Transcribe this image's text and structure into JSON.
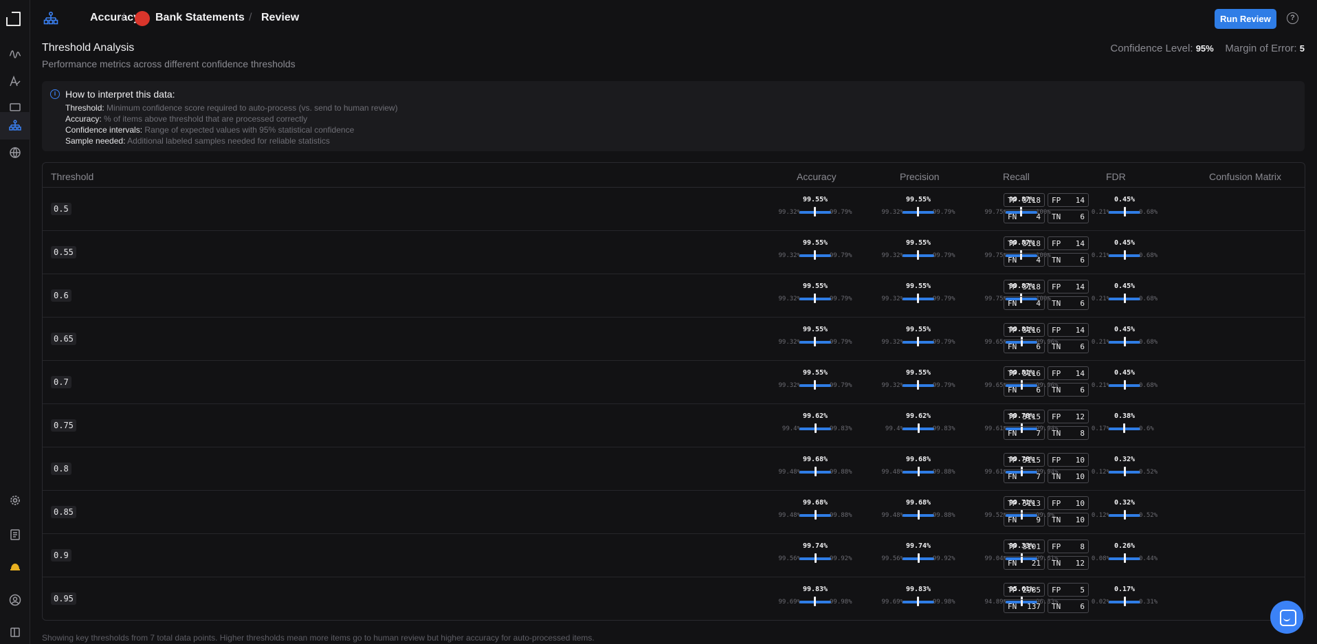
{
  "breadcrumb": {
    "section": "Accuracy",
    "project": "Bank Statements",
    "page": "Review",
    "separator": "/"
  },
  "header": {
    "run_button": "Run Review",
    "help_icon": "?"
  },
  "analysis": {
    "title": "Threshold Analysis",
    "subtitle": "Performance metrics across different confidence thresholds",
    "confidence_label": "Confidence Level:",
    "confidence_value": "95%",
    "margin_label": "Margin of Error:",
    "margin_value": "5"
  },
  "info": {
    "title": "How to interpret this data:",
    "lines": [
      {
        "key": "Threshold:",
        "text": "Minimum confidence score required to auto-process (vs. send to human review)"
      },
      {
        "key": "Accuracy:",
        "text": "% of items above threshold that are processed correctly"
      },
      {
        "key": "Confidence intervals:",
        "text": "Range of expected values with 95% statistical confidence"
      },
      {
        "key": "Sample needed:",
        "text": "Additional labeled samples needed for reliable statistics"
      }
    ]
  },
  "table": {
    "columns": [
      "Threshold",
      "Accuracy",
      "Precision",
      "Recall",
      "FDR",
      "Confusion Matrix"
    ],
    "cm_labels": [
      "TP",
      "FP",
      "FN",
      "TN"
    ],
    "rows": [
      {
        "threshold": "0.5",
        "acc": [
          "99.55%",
          "99.32%",
          "99.79%"
        ],
        "prec": [
          "99.55%",
          "99.32%",
          "99.79%"
        ],
        "rec": [
          "99.87%",
          "99.75%",
          "100%"
        ],
        "fdr": [
          "0.45%",
          "0.21%",
          "0.68%"
        ],
        "tp": "3118",
        "fp": "14",
        "fn": "4",
        "tn": "6"
      },
      {
        "threshold": "0.55",
        "acc": [
          "99.55%",
          "99.32%",
          "99.79%"
        ],
        "prec": [
          "99.55%",
          "99.32%",
          "99.79%"
        ],
        "rec": [
          "99.87%",
          "99.75%",
          "100%"
        ],
        "fdr": [
          "0.45%",
          "0.21%",
          "0.68%"
        ],
        "tp": "3118",
        "fp": "14",
        "fn": "4",
        "tn": "6"
      },
      {
        "threshold": "0.6",
        "acc": [
          "99.55%",
          "99.32%",
          "99.79%"
        ],
        "prec": [
          "99.55%",
          "99.32%",
          "99.79%"
        ],
        "rec": [
          "99.87%",
          "99.75%",
          "100%"
        ],
        "fdr": [
          "0.45%",
          "0.21%",
          "0.68%"
        ],
        "tp": "3118",
        "fp": "14",
        "fn": "4",
        "tn": "6"
      },
      {
        "threshold": "0.65",
        "acc": [
          "99.55%",
          "99.32%",
          "99.79%"
        ],
        "prec": [
          "99.55%",
          "99.32%",
          "99.79%"
        ],
        "rec": [
          "99.81%",
          "99.65%",
          "99.96%"
        ],
        "fdr": [
          "0.45%",
          "0.21%",
          "0.68%"
        ],
        "tp": "3116",
        "fp": "14",
        "fn": "6",
        "tn": "6"
      },
      {
        "threshold": "0.7",
        "acc": [
          "99.55%",
          "99.32%",
          "99.79%"
        ],
        "prec": [
          "99.55%",
          "99.32%",
          "99.79%"
        ],
        "rec": [
          "99.81%",
          "99.65%",
          "99.96%"
        ],
        "fdr": [
          "0.45%",
          "0.21%",
          "0.68%"
        ],
        "tp": "3116",
        "fp": "14",
        "fn": "6",
        "tn": "6"
      },
      {
        "threshold": "0.75",
        "acc": [
          "99.62%",
          "99.4%",
          "99.83%"
        ],
        "prec": [
          "99.62%",
          "99.4%",
          "99.83%"
        ],
        "rec": [
          "99.78%",
          "99.61%",
          "99.94%"
        ],
        "fdr": [
          "0.38%",
          "0.17%",
          "0.6%"
        ],
        "tp": "3115",
        "fp": "12",
        "fn": "7",
        "tn": "8"
      },
      {
        "threshold": "0.8",
        "acc": [
          "99.68%",
          "99.48%",
          "99.88%"
        ],
        "prec": [
          "99.68%",
          "99.48%",
          "99.88%"
        ],
        "rec": [
          "99.78%",
          "99.61%",
          "99.94%"
        ],
        "fdr": [
          "0.32%",
          "0.12%",
          "0.52%"
        ],
        "tp": "3115",
        "fp": "10",
        "fn": "7",
        "tn": "10"
      },
      {
        "threshold": "0.85",
        "acc": [
          "99.68%",
          "99.48%",
          "99.88%"
        ],
        "prec": [
          "99.68%",
          "99.48%",
          "99.88%"
        ],
        "rec": [
          "99.71%",
          "99.52%",
          "99.9%"
        ],
        "fdr": [
          "0.32%",
          "0.12%",
          "0.52%"
        ],
        "tp": "3113",
        "fp": "10",
        "fn": "9",
        "tn": "10"
      },
      {
        "threshold": "0.9",
        "acc": [
          "99.74%",
          "99.56%",
          "99.92%"
        ],
        "prec": [
          "99.74%",
          "99.56%",
          "99.92%"
        ],
        "rec": [
          "99.33%",
          "99.04%",
          "99.61%"
        ],
        "fdr": [
          "0.26%",
          "0.08%",
          "0.44%"
        ],
        "tp": "3101",
        "fp": "8",
        "fn": "21",
        "tn": "12"
      },
      {
        "threshold": "0.95",
        "acc": [
          "99.83%",
          "99.69%",
          "99.98%"
        ],
        "prec": [
          "99.83%",
          "99.69%",
          "99.98%"
        ],
        "rec": [
          "95.61%",
          "94.89%",
          "96.33%"
        ],
        "fdr": [
          "0.17%",
          "0.02%",
          "0.31%"
        ],
        "tp": "2985",
        "fp": "5",
        "fn": "137",
        "tn": "6"
      }
    ]
  },
  "footnote": "Showing key thresholds from 7 total data points. Higher thresholds mean more items go to human review but higher accuracy for auto-processed items.",
  "colors": {
    "accent": "#2f7de6",
    "project_dot": "#d9352b",
    "background": "#121214"
  }
}
